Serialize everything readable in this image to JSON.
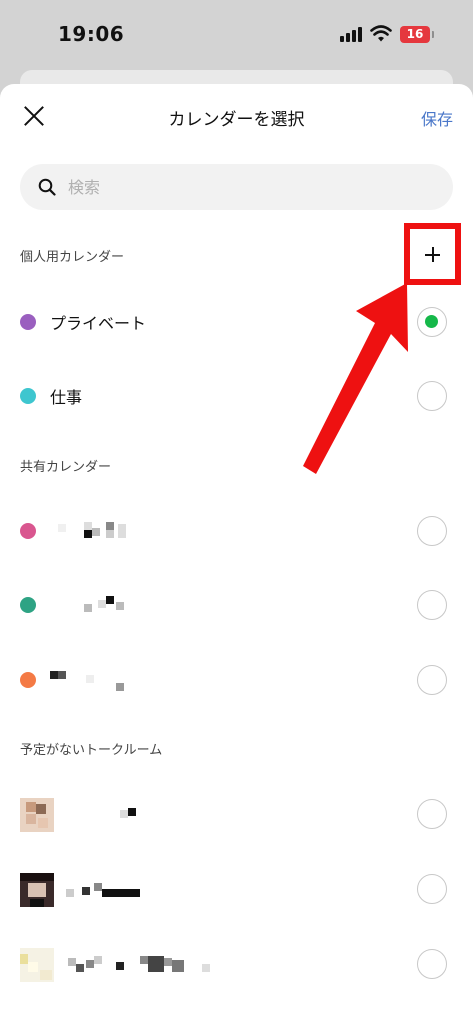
{
  "status_bar": {
    "time": "19:06",
    "battery": "16"
  },
  "header": {
    "title": "カレンダーを選択",
    "save_label": "保存"
  },
  "search": {
    "placeholder": "検索"
  },
  "sections": {
    "personal": "個人用カレンダー",
    "shared": "共有カレンダー",
    "rooms": "予定がないトークルーム"
  },
  "personal_calendars": [
    {
      "label": "プライベート",
      "color": "#9a5fbf",
      "selected": true
    },
    {
      "label": "仕事",
      "color": "#3ec6cf",
      "selected": false
    }
  ],
  "shared_calendars": [
    {
      "color": "#d9568f",
      "selected": false
    },
    {
      "color": "#2ea384",
      "selected": false
    },
    {
      "color": "#f47a45",
      "selected": false
    }
  ],
  "colors": {
    "accent": "#4a77c9",
    "selected": "#15b84a",
    "highlight": "#ee1111"
  }
}
